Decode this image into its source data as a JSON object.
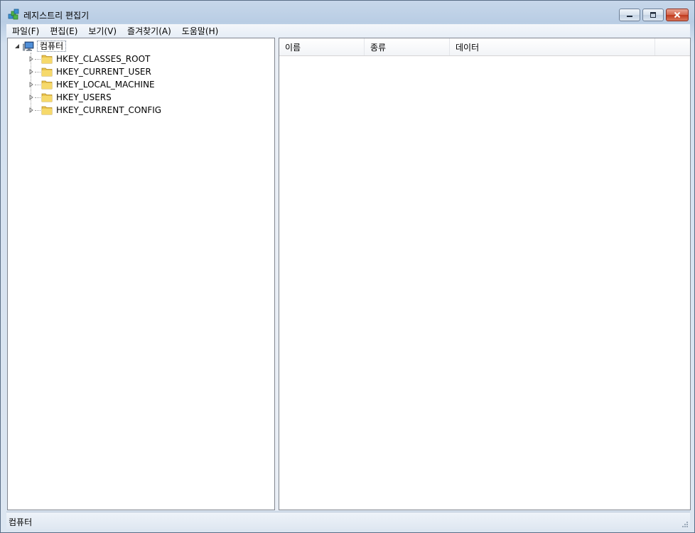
{
  "window": {
    "title": "레지스트리 편집기",
    "icon": "registry-editor-icon"
  },
  "menu": [
    {
      "label": "파일(F)"
    },
    {
      "label": "편집(E)"
    },
    {
      "label": "보기(V)"
    },
    {
      "label": "즐겨찾기(A)"
    },
    {
      "label": "도움말(H)"
    }
  ],
  "tree": {
    "root": {
      "label": "컴퓨터",
      "icon": "computer-icon",
      "expanded": true,
      "selected": true
    },
    "keys": [
      {
        "label": "HKEY_CLASSES_ROOT",
        "icon": "folder-icon"
      },
      {
        "label": "HKEY_CURRENT_USER",
        "icon": "folder-icon"
      },
      {
        "label": "HKEY_LOCAL_MACHINE",
        "icon": "folder-icon"
      },
      {
        "label": "HKEY_USERS",
        "icon": "folder-icon"
      },
      {
        "label": "HKEY_CURRENT_CONFIG",
        "icon": "folder-icon"
      }
    ]
  },
  "list": {
    "columns": [
      {
        "label": "이름"
      },
      {
        "label": "종류"
      },
      {
        "label": "데이터"
      }
    ],
    "rows": []
  },
  "statusbar": {
    "path": "컴퓨터"
  },
  "colors": {
    "frame": "#c7d7ea",
    "close_button": "#c0391d",
    "pane_background": "#ffffff"
  }
}
